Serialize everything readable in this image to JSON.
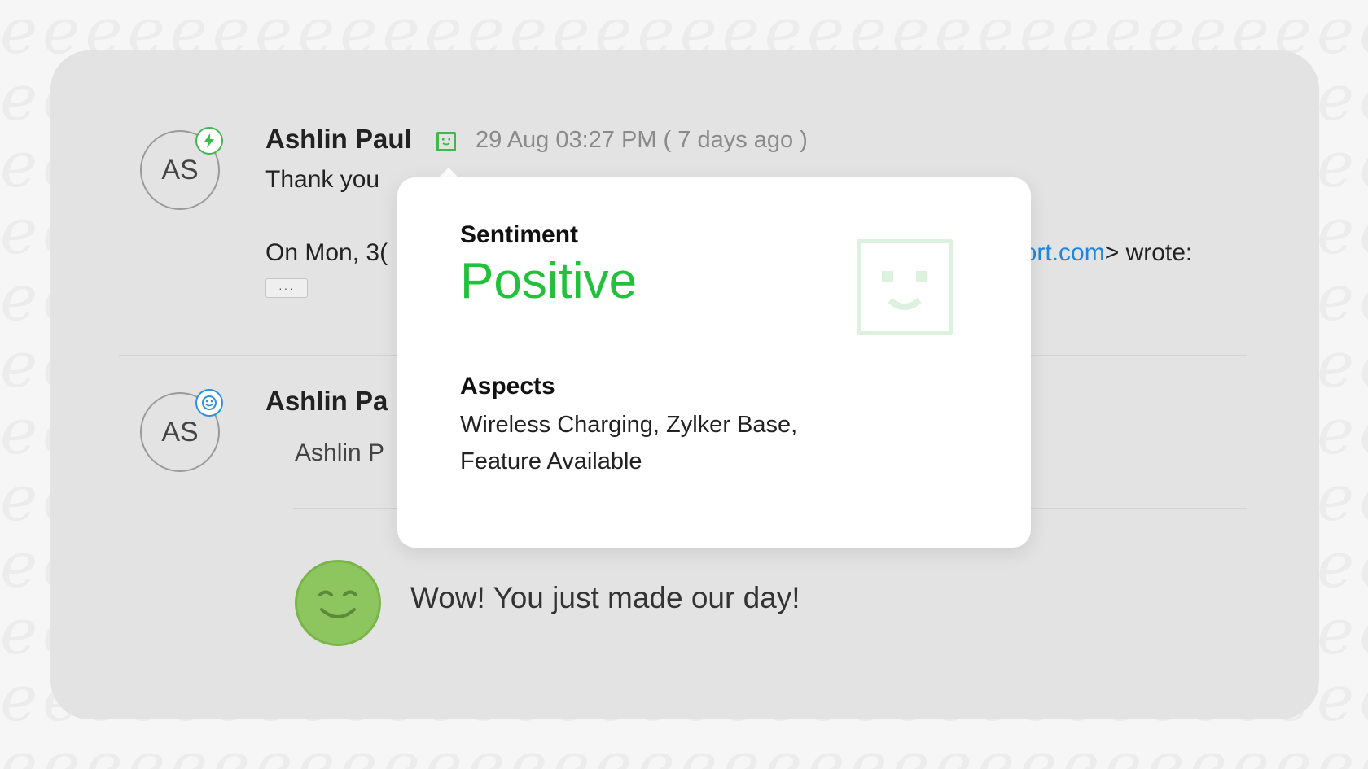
{
  "thread": {
    "message1": {
      "avatar_initials": "AS",
      "author": "Ashlin Paul",
      "timestamp": "29 Aug 03:27 PM ( 7 days ago )",
      "text_preview": "Thank you",
      "quote_prefix": "On Mon, 3(",
      "quote_link": "port.com",
      "quote_suffix": "> wrote:",
      "ellipsis": "···"
    },
    "message2": {
      "avatar_initials": "AS",
      "author": "Ashlin Pa",
      "sub_text": "Ashlin P"
    },
    "feedback": {
      "text": "Wow! You just made our day!"
    }
  },
  "sentiment_popup": {
    "sentiment_label": "Sentiment",
    "sentiment_value": "Positive",
    "aspects_label": "Aspects",
    "aspects_line1": "Wireless Charging, Zylker Base,",
    "aspects_line2": "Feature Available"
  },
  "colors": {
    "positive": "#22c13b",
    "link": "#1f86dc",
    "smiley": "#8dc65e",
    "card_bg": "#e3e3e3"
  },
  "icons": [
    "bolt-icon",
    "sentiment-positive-icon",
    "feedback-icon",
    "smiley-icon"
  ]
}
